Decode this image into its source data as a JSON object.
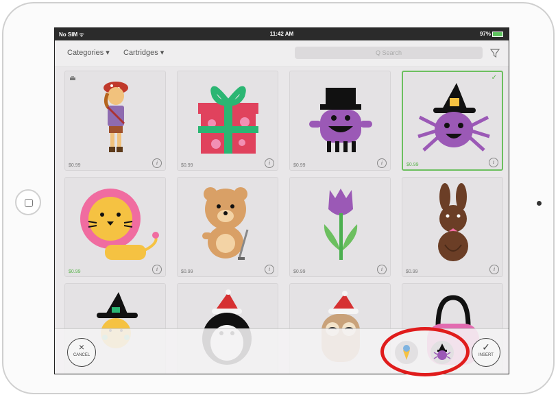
{
  "status_bar": {
    "carrier": "No SIM ᯤ",
    "time": "11:42 AM",
    "battery": "97%"
  },
  "nav": {
    "categories": "Categories ▾",
    "cartridges": "Cartridges ▾",
    "search_placeholder": "Q Search"
  },
  "images": [
    {
      "name": "pirate-girl",
      "price": "$0.99",
      "selected": false
    },
    {
      "name": "gift-box",
      "price": "$0.99",
      "selected": false
    },
    {
      "name": "purple-monster-top-hat",
      "price": "$0.99",
      "selected": false
    },
    {
      "name": "witch-spider",
      "price": "$0.99",
      "selected": true
    },
    {
      "name": "lion",
      "price": "$0.99",
      "selected": false
    },
    {
      "name": "teddy-bear-golf",
      "price": "$0.99",
      "selected": false
    },
    {
      "name": "tulip",
      "price": "$0.99",
      "selected": false
    },
    {
      "name": "chocolate-bunny",
      "price": "$0.99",
      "selected": false
    },
    {
      "name": "witch-chick",
      "price": "",
      "selected": false
    },
    {
      "name": "santa-penguin",
      "price": "",
      "selected": false
    },
    {
      "name": "santa-owl",
      "price": "",
      "selected": false
    },
    {
      "name": "pink-bag",
      "price": "",
      "selected": false
    }
  ],
  "info_glyph": "i",
  "check_glyph": "✓",
  "bottom": {
    "cancel_symbol": "×",
    "cancel_label": "CANCEL",
    "insert_symbol": "✓",
    "insert_label": "INSERT"
  },
  "colors": {
    "selected_border": "#6cbf5f",
    "highlight_circle": "#e01c1c",
    "status_bar": "#2b2b2b"
  }
}
